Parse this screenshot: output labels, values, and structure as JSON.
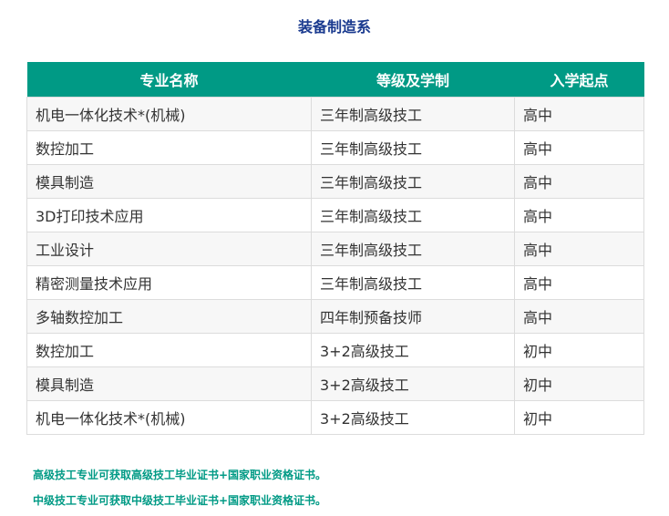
{
  "page": {
    "title": "装备制造系"
  },
  "table": {
    "headers": [
      "专业名称",
      "等级及学制",
      "入学起点"
    ],
    "rows": [
      [
        "机电一体化技术*(机械)",
        "三年制高级技工",
        "高中"
      ],
      [
        "数控加工",
        "三年制高级技工",
        "高中"
      ],
      [
        "模具制造",
        "三年制高级技工",
        "高中"
      ],
      [
        "3D打印技术应用",
        "三年制高级技工",
        "高中"
      ],
      [
        "工业设计",
        "三年制高级技工",
        "高中"
      ],
      [
        "精密测量技术应用",
        "三年制高级技工",
        "高中"
      ],
      [
        "多轴数控加工",
        "四年制预备技师",
        "高中"
      ],
      [
        "数控加工",
        "3+2高级技工",
        "初中"
      ],
      [
        "模具制造",
        "3+2高级技工",
        "初中"
      ],
      [
        "机电一体化技术*(机械)",
        "3+2高级技工",
        "初中"
      ]
    ]
  },
  "notes": [
    "高级技工专业可获取高级技工毕业证书+国家职业资格证书。",
    "中级技工专业可获取中级技工毕业证书+国家职业资格证书。"
  ],
  "colors": {
    "header_bg": "#009a85",
    "title": "#1a3a8f",
    "note": "#009a85"
  }
}
